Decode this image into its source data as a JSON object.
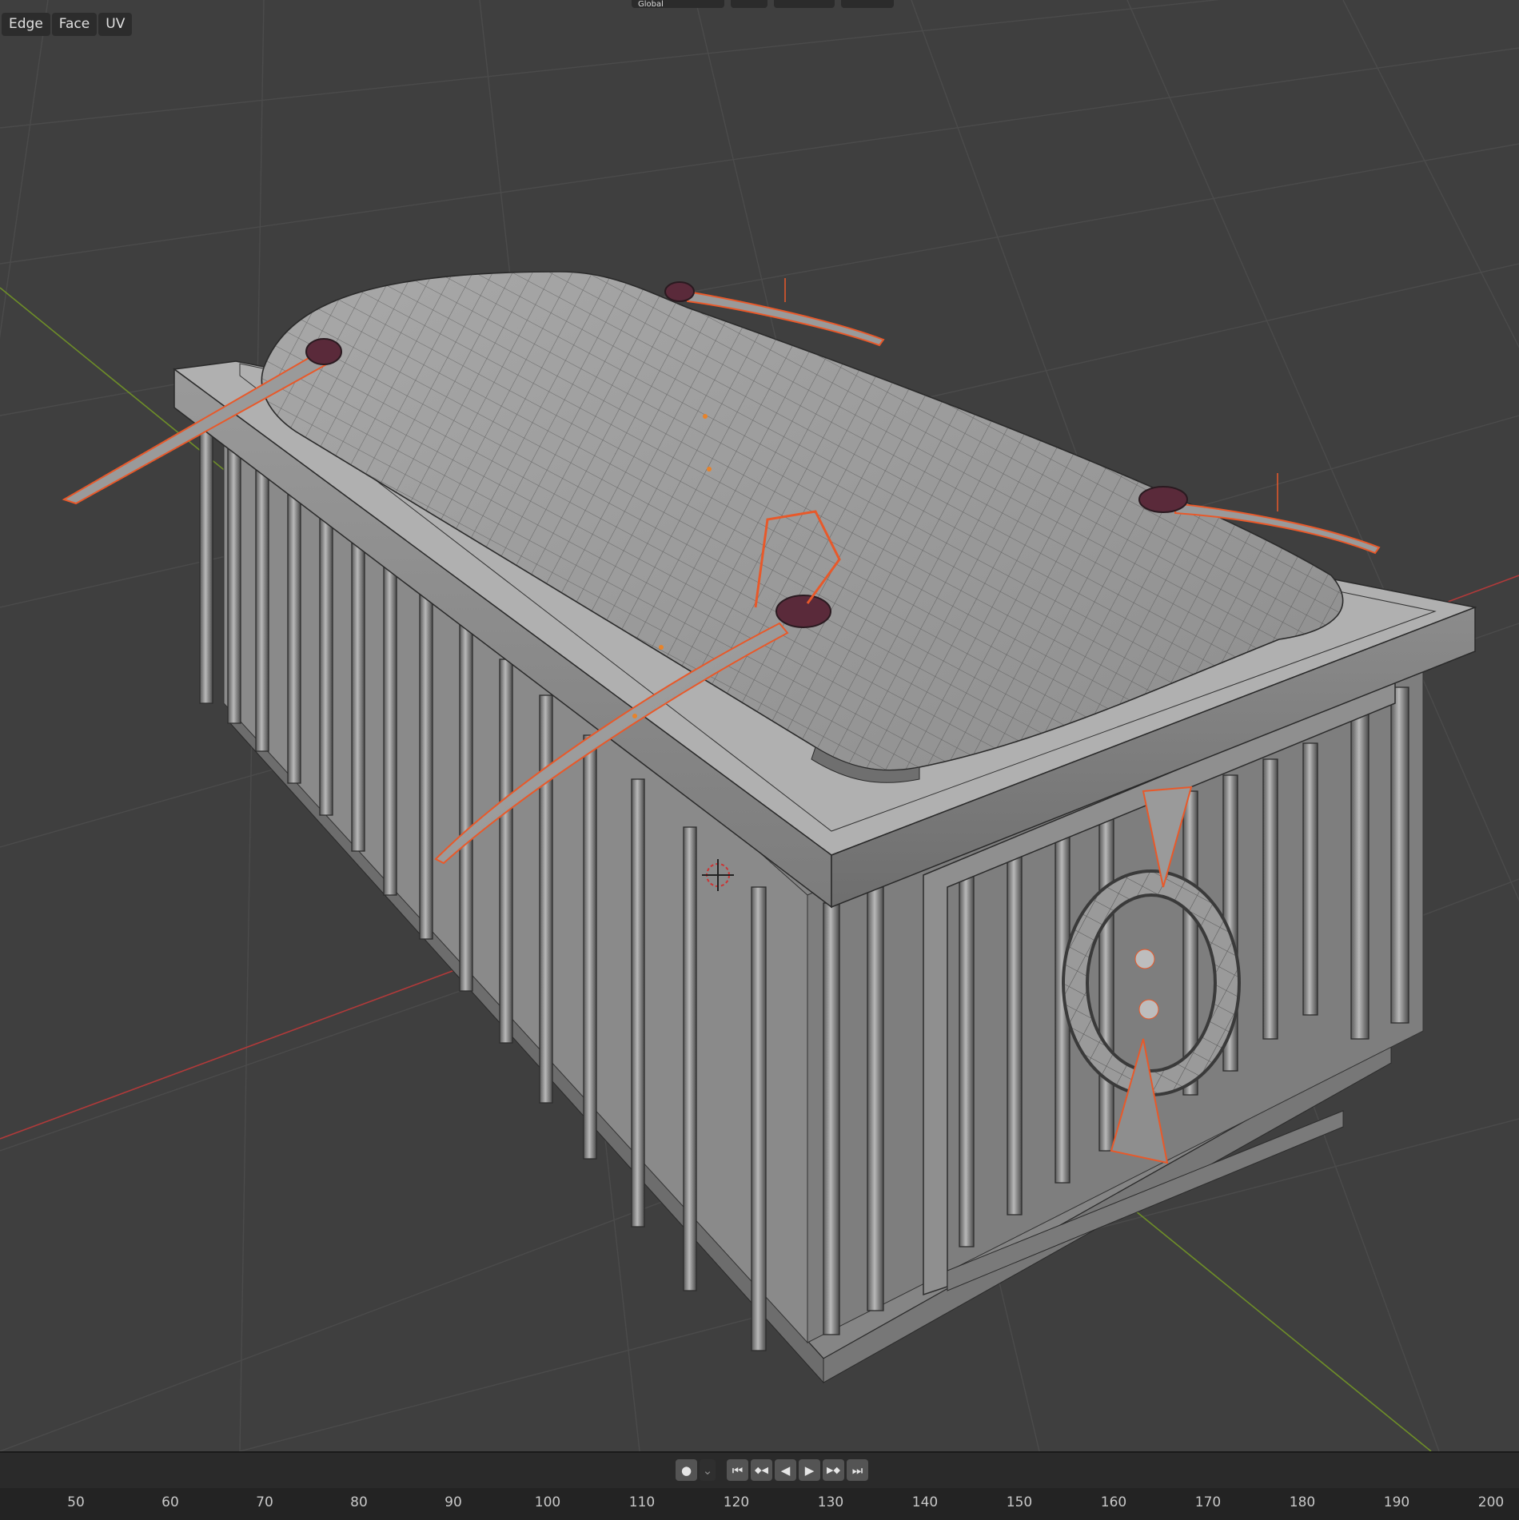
{
  "header": {
    "mode_label": "Global",
    "items": [
      "Global",
      "⊙",
      "∥∥",
      "⊖"
    ]
  },
  "edit_menu": {
    "items": [
      {
        "label": "Edge"
      },
      {
        "label": "Face"
      },
      {
        "label": "UV"
      }
    ]
  },
  "viewport": {
    "background": "#3f3f3f",
    "grid_color": "#4a4a4a",
    "x_axis_color": "#b03a3a",
    "y_axis_color": "#7a9a2a",
    "selection_color": "#e8592a",
    "mesh_color": "#8c8c8c",
    "scene": "cage mesh with tufted cushion top, hooks and ring, edit mode wireframe"
  },
  "timeline": {
    "playback_buttons": [
      {
        "icon": "record-icon",
        "glyph": "●"
      },
      {
        "icon": "dropdown-icon",
        "glyph": "⌄"
      },
      {
        "icon": "jump-start-icon",
        "glyph": "⏮"
      },
      {
        "icon": "prev-keyframe-icon",
        "glyph": "◆◀"
      },
      {
        "icon": "play-reverse-icon",
        "glyph": "◀"
      },
      {
        "icon": "play-icon",
        "glyph": "▶"
      },
      {
        "icon": "next-keyframe-icon",
        "glyph": "▶◆"
      },
      {
        "icon": "jump-end-icon",
        "glyph": "⏭"
      }
    ],
    "ticks": [
      "50",
      "60",
      "70",
      "80",
      "90",
      "100",
      "110",
      "120",
      "130",
      "140",
      "150",
      "160",
      "170",
      "180",
      "190",
      "200"
    ]
  }
}
